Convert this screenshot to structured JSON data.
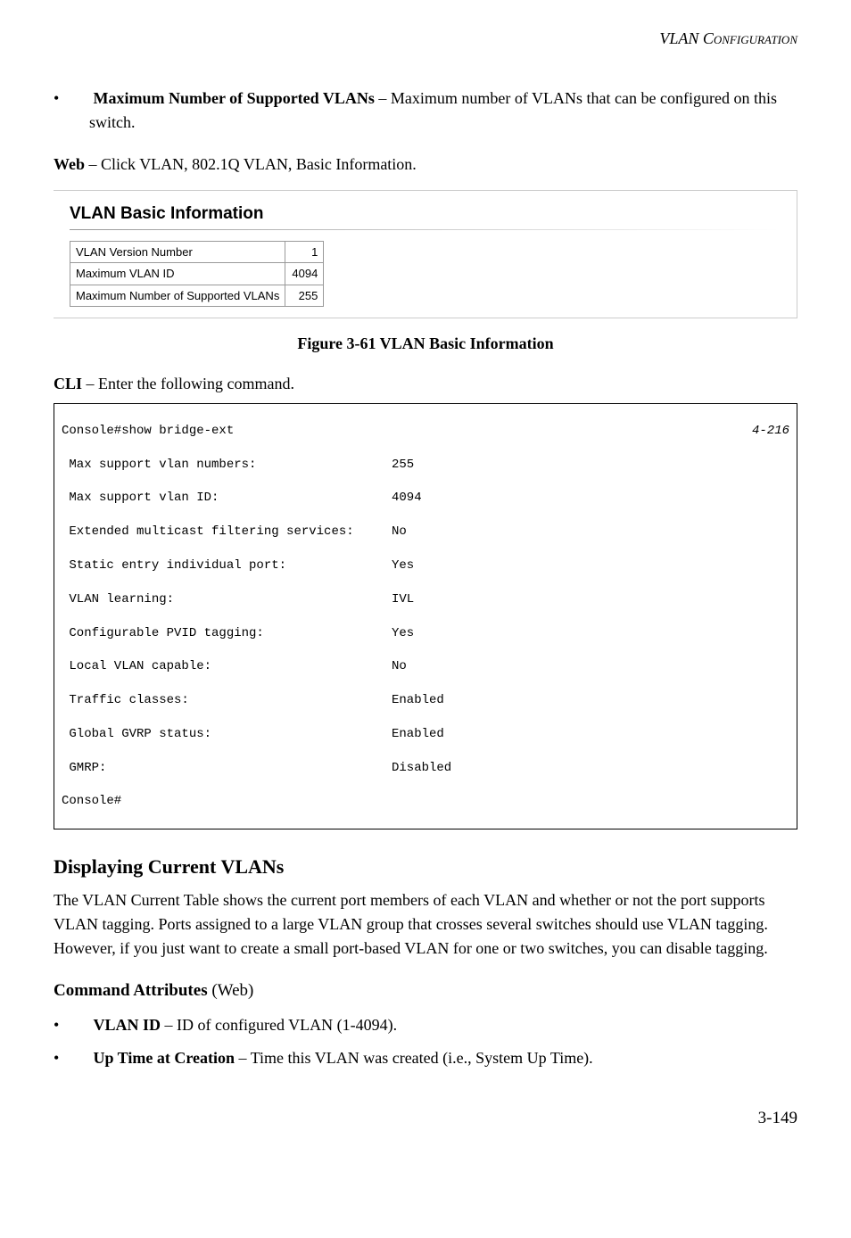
{
  "header": {
    "section": "VLAN Configuration"
  },
  "bullet1": {
    "label": "Maximum Number of Supported VLANs",
    "desc": " – Maximum number of VLANs that can be configured on this switch."
  },
  "web": {
    "label": "Web",
    "desc": " – Click VLAN, 802.1Q VLAN, Basic Information."
  },
  "screenshot": {
    "title": "VLAN Basic Information",
    "rows": [
      {
        "label": "VLAN Version Number",
        "value": "1"
      },
      {
        "label": "Maximum VLAN ID",
        "value": "4094"
      },
      {
        "label": "Maximum Number of Supported VLANs",
        "value": "255"
      }
    ]
  },
  "figure": {
    "caption": "Figure 3-61  VLAN Basic Information"
  },
  "cli_intro": {
    "label": "CLI",
    "desc": " – Enter the following command."
  },
  "cli": {
    "head": "Console#show bridge-ext",
    "ref": "4-216",
    "rows": [
      {
        "l": " Max support vlan numbers:",
        "r": "255"
      },
      {
        "l": " Max support vlan ID:",
        "r": "4094"
      },
      {
        "l": " Extended multicast filtering services:",
        "r": "No"
      },
      {
        "l": " Static entry individual port:",
        "r": "Yes"
      },
      {
        "l": " VLAN learning:",
        "r": "IVL"
      },
      {
        "l": " Configurable PVID tagging:",
        "r": "Yes"
      },
      {
        "l": " Local VLAN capable:",
        "r": "No"
      },
      {
        "l": " Traffic classes:",
        "r": "Enabled"
      },
      {
        "l": " Global GVRP status:",
        "r": "Enabled"
      },
      {
        "l": " GMRP:",
        "r": "Disabled"
      }
    ],
    "tail": "Console#"
  },
  "section2": {
    "title": "Displaying Current VLANs",
    "body": "The VLAN Current Table shows the current port members of each VLAN and whether or not the port supports VLAN tagging. Ports assigned to a large VLAN group that crosses several switches should use VLAN tagging. However, if you just want to create a small port-based VLAN for one or two switches, you can disable tagging."
  },
  "cmd_attr": {
    "head_bold": "Command Attributes",
    "head_rest": " (Web)",
    "items": [
      {
        "label": "VLAN ID",
        "desc": " – ID of configured VLAN (1-4094)."
      },
      {
        "label": "Up Time at Creation",
        "desc": " – Time this VLAN was created (i.e., System Up Time)."
      }
    ]
  },
  "page_num": "3-149"
}
